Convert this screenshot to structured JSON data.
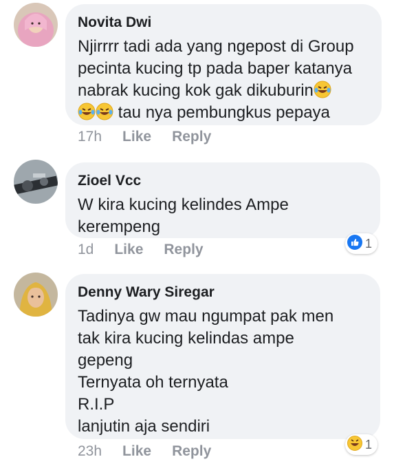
{
  "comments": [
    {
      "author": "Novita Dwi",
      "text": "Njirrrr tadi ada yang ngepost di Group\npecinta kucing tp pada baper katanya\nnabrak kucing kok gak dikuburin",
      "text_tail": " tau nya pembungkus pepaya",
      "time": "17h",
      "like": "Like",
      "reply": "Reply"
    },
    {
      "author": "Zioel Vcc",
      "text": "W kira kucing kelindes Ampe\nkerempeng",
      "time": "1d",
      "like": "Like",
      "reply": "Reply",
      "reaction_count": "1",
      "reaction_icon": "like-icon"
    },
    {
      "author": "Denny Wary Siregar",
      "text": "Tadinya gw mau ngumpat pak men\ntak kira kucing kelindas ampe\ngepeng\nTernyata oh ternyata\nR.I.P\nlanjutin aja sendiri",
      "time": "23h",
      "like": "Like",
      "reply": "Reply",
      "reaction_count": "1",
      "reaction_icon": "haha-icon"
    }
  ],
  "colors": {
    "bubble": "#f0f2f5",
    "meta": "#90949c",
    "like_blue": "#1877f2"
  }
}
